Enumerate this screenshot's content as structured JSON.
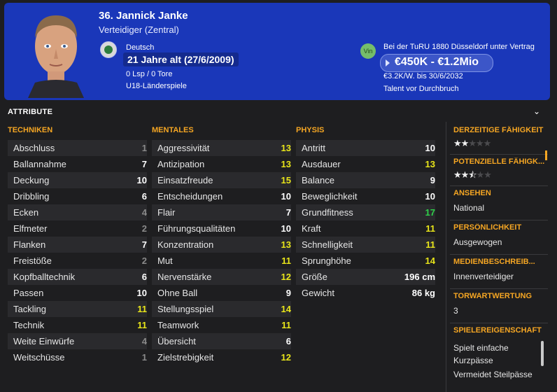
{
  "player": {
    "name": "36. Jannick Janke",
    "position": "Verteidiger (Zentral)",
    "nationality": "Deutsch",
    "age": "21 Jahre alt (27/6/2009)",
    "stats": "0 Lsp / 0 Tore",
    "youth_caps": "U18-Länderspiele",
    "club_badge": "Vin",
    "contract": "Bei der TuRU 1880 Düsseldorf unter Vertrag",
    "value": "€450K - €1.2Mio",
    "wage": "€3.2K/W. bis 30/6/2032",
    "talent": "Talent vor Durchbruch"
  },
  "section_title": "ATTRIBUTE",
  "columns": [
    {
      "title": "TECHNIKEN",
      "rows": [
        {
          "label": "Abschluss",
          "value": "1"
        },
        {
          "label": "Ballannahme",
          "value": "7"
        },
        {
          "label": "Deckung",
          "value": "10"
        },
        {
          "label": "Dribbling",
          "value": "6"
        },
        {
          "label": "Ecken",
          "value": "4"
        },
        {
          "label": "Elfmeter",
          "value": "2"
        },
        {
          "label": "Flanken",
          "value": "7"
        },
        {
          "label": "Freistöße",
          "value": "2"
        },
        {
          "label": "Kopfballtechnik",
          "value": "6"
        },
        {
          "label": "Passen",
          "value": "10"
        },
        {
          "label": "Tackling",
          "value": "11"
        },
        {
          "label": "Technik",
          "value": "11"
        },
        {
          "label": "Weite Einwürfe",
          "value": "4"
        },
        {
          "label": "Weitschüsse",
          "value": "1"
        }
      ]
    },
    {
      "title": "MENTALES",
      "rows": [
        {
          "label": "Aggressivität",
          "value": "13"
        },
        {
          "label": "Antizipation",
          "value": "13"
        },
        {
          "label": "Einsatzfreude",
          "value": "15"
        },
        {
          "label": "Entscheidungen",
          "value": "10"
        },
        {
          "label": "Flair",
          "value": "7"
        },
        {
          "label": "Führungsqualitäten",
          "value": "10"
        },
        {
          "label": "Konzentration",
          "value": "13"
        },
        {
          "label": "Mut",
          "value": "11"
        },
        {
          "label": "Nervenstärke",
          "value": "12"
        },
        {
          "label": "Ohne Ball",
          "value": "9"
        },
        {
          "label": "Stellungsspiel",
          "value": "14"
        },
        {
          "label": "Teamwork",
          "value": "11"
        },
        {
          "label": "Übersicht",
          "value": "6"
        },
        {
          "label": "Zielstrebigkeit",
          "value": "12"
        }
      ]
    },
    {
      "title": "PHYSIS",
      "rows": [
        {
          "label": "Antritt",
          "value": "10"
        },
        {
          "label": "Ausdauer",
          "value": "13"
        },
        {
          "label": "Balance",
          "value": "9"
        },
        {
          "label": "Beweglichkeit",
          "value": "10"
        },
        {
          "label": "Grundfitness",
          "value": "17"
        },
        {
          "label": "Kraft",
          "value": "11"
        },
        {
          "label": "Schnelligkeit",
          "value": "11"
        },
        {
          "label": "Sprunghöhe",
          "value": "14"
        },
        {
          "label": "Größe",
          "value": "196 cm"
        },
        {
          "label": "Gewicht",
          "value": "86 kg"
        }
      ]
    }
  ],
  "sidebar": {
    "current_ability": {
      "label": "DERZEITIGE FÄHIGKEIT",
      "stars": 2.0
    },
    "potential_ability": {
      "label": "POTENZIELLE FÄHIGK...",
      "stars": 2.5
    },
    "reputation": {
      "label": "ANSEHEN",
      "value": "National"
    },
    "personality": {
      "label": "PERSÖNLICHKEIT",
      "value": "Ausgewogen"
    },
    "media": {
      "label": "MEDIENBESCHREIB...",
      "value": "Innenverteidiger"
    },
    "gk_rating": {
      "label": "TORWARTWERTUNG",
      "value": "3"
    },
    "traits": {
      "label": "SPIELEREIGENSCHAFT",
      "items": [
        "Spielt einfache Kurzpässe",
        "Vermeidet Steilpässe"
      ]
    }
  },
  "colors": {
    "header_bg": "#1a37b9",
    "accent": "#f5a623",
    "value_low": "#8a8a8a",
    "value_mid": "#ffffff",
    "value_good": "#e8e51a",
    "value_great": "#2fd04a"
  }
}
